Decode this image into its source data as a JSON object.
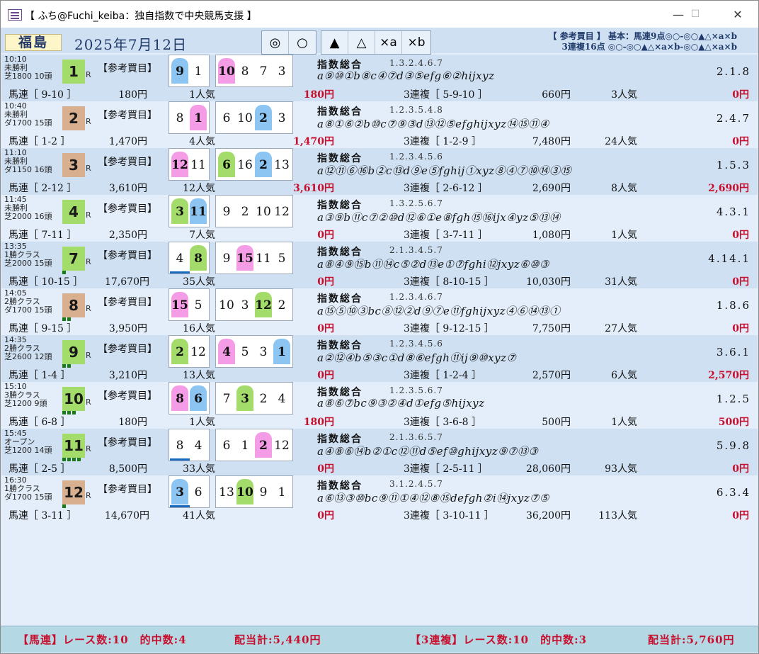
{
  "window": {
    "title": "【 ふち@Fuchi_keiba：独自指数で中央競馬支援 】",
    "minimize": "—",
    "maximize": "☐",
    "close": "✕"
  },
  "header": {
    "venue": "福島",
    "date": "2025年7月12日",
    "marks": [
      "◎",
      "○",
      "▲",
      "△",
      "×a",
      "×b"
    ],
    "info_line1": "【 参考買目 】 基本：馬連9点◎○-◎○▲△×a×b",
    "info_line2": "3連複16点 ◎○-◎○▲△×a×b-◎○▲△×a×b"
  },
  "races": [
    {
      "time": "10:10",
      "cls": "未勝利",
      "course": "芝1800 10頭",
      "num": "1",
      "num_color": "#a4dc6c",
      "dots": 0,
      "sanko": "【参考買目】",
      "top": [
        {
          "n": "9",
          "c": "blue"
        },
        {
          "n": "1",
          "c": "none"
        }
      ],
      "others": [
        {
          "n": "10",
          "c": "pink"
        },
        {
          "n": "8",
          "c": "none"
        },
        {
          "n": "7",
          "c": "none"
        },
        {
          "n": "3",
          "c": "none"
        }
      ],
      "shisu": "指数総合",
      "shisu_nums": "1.3.2.4.6.7",
      "seq": "a⑨⑩①b⑧c④⑦d③⑤efg⑥②hijxyz",
      "trio": "2.1.8",
      "umaren": "馬連［ 9-10 ］",
      "umaren_pay": "180円",
      "umaren_pop": "1人気",
      "umaren_hit": "180円",
      "sanren": "3連複［ 5-9-10 ］",
      "sanren_pay": "660円",
      "sanren_pop": "3人気",
      "sanren_hit": "0円"
    },
    {
      "time": "10:40",
      "cls": "未勝利",
      "course": "ダ1700 15頭",
      "num": "2",
      "num_color": "#d8b090",
      "dots": 0,
      "sanko": "【参考買目】",
      "top": [
        {
          "n": "8",
          "c": "none"
        },
        {
          "n": "1",
          "c": "pink"
        }
      ],
      "others": [
        {
          "n": "6",
          "c": "none"
        },
        {
          "n": "10",
          "c": "none"
        },
        {
          "n": "2",
          "c": "blue"
        },
        {
          "n": "3",
          "c": "none"
        }
      ],
      "shisu": "指数総合",
      "shisu_nums": "1.2.3.5.4.8",
      "seq": "a⑧①⑥②b⑩c⑦⑨③d⑬⑫⑤efghijxyz⑭⑮⑪④",
      "trio": "2.4.7",
      "umaren": "馬連［ 1-2 ］",
      "umaren_pay": "1,470円",
      "umaren_pop": "4人気",
      "umaren_hit": "1,470円",
      "sanren": "3連複［ 1-2-9 ］",
      "sanren_pay": "7,480円",
      "sanren_pop": "24人気",
      "sanren_hit": "0円"
    },
    {
      "time": "11:10",
      "cls": "未勝利",
      "course": "ダ1150 16頭",
      "num": "3",
      "num_color": "#d8b090",
      "dots": 0,
      "sanko": "【参考買目】",
      "top": [
        {
          "n": "12",
          "c": "pink"
        },
        {
          "n": "11",
          "c": "none"
        }
      ],
      "others": [
        {
          "n": "6",
          "c": "green"
        },
        {
          "n": "16",
          "c": "none"
        },
        {
          "n": "2",
          "c": "blue"
        },
        {
          "n": "13",
          "c": "none"
        }
      ],
      "shisu": "指数総合",
      "shisu_nums": "1.2.3.4.5.6",
      "seq": "a⑫⑪⑥⑯b②c⑬d⑨e⑤fghij①xyz⑧④⑦⑩⑭③⑮",
      "trio": "1.5.3",
      "umaren": "馬連［ 2-12 ］",
      "umaren_pay": "3,610円",
      "umaren_pop": "12人気",
      "umaren_hit": "3,610円",
      "sanren": "3連複［ 2-6-12 ］",
      "sanren_pay": "2,690円",
      "sanren_pop": "8人気",
      "sanren_hit": "2,690円"
    },
    {
      "time": "11:45",
      "cls": "未勝利",
      "course": "芝2000 16頭",
      "num": "4",
      "num_color": "#a4dc6c",
      "dots": 0,
      "sanko": "【参考買目】",
      "top": [
        {
          "n": "3",
          "c": "green"
        },
        {
          "n": "11",
          "c": "blue"
        }
      ],
      "others": [
        {
          "n": "9",
          "c": "none"
        },
        {
          "n": "2",
          "c": "none"
        },
        {
          "n": "10",
          "c": "none"
        },
        {
          "n": "12",
          "c": "none"
        }
      ],
      "shisu": "指数総合",
      "shisu_nums": "1.3.2.5.6.7",
      "seq": "a③⑨b⑪c⑦②⑩d⑫⑥①e⑧fgh⑮⑯ijx④yz⑤⑬⑭",
      "trio": "4.3.1",
      "umaren": "馬連［ 7-11 ］",
      "umaren_pay": "2,350円",
      "umaren_pop": "7人気",
      "umaren_hit": "0円",
      "sanren": "3連複［ 3-7-11 ］",
      "sanren_pay": "1,080円",
      "sanren_pop": "1人気",
      "sanren_hit": "0円"
    },
    {
      "time": "13:35",
      "cls": "1勝クラス",
      "course": "芝2000 15頭",
      "num": "7",
      "num_color": "#a4dc6c",
      "dots": 1,
      "sanko": "【参考買目】",
      "top": [
        {
          "n": "4",
          "c": "none",
          "ul": true
        },
        {
          "n": "8",
          "c": "green"
        }
      ],
      "others": [
        {
          "n": "9",
          "c": "none"
        },
        {
          "n": "15",
          "c": "pink"
        },
        {
          "n": "11",
          "c": "none"
        },
        {
          "n": "5",
          "c": "none"
        }
      ],
      "shisu": "指数総合",
      "shisu_nums": "2.1.3.4.5.7",
      "seq": "a⑧④⑨⑮b⑪⑭c⑤②d⑬e①⑦fghi⑫jxyz⑥⑩③",
      "trio": "4.14.1",
      "umaren": "馬連［ 10-15 ］",
      "umaren_pay": "17,670円",
      "umaren_pop": "35人気",
      "umaren_hit": "0円",
      "sanren": "3連複［ 8-10-15 ］",
      "sanren_pay": "10,030円",
      "sanren_pop": "31人気",
      "sanren_hit": "0円"
    },
    {
      "time": "14:05",
      "cls": "2勝クラス",
      "course": "ダ1700 15頭",
      "num": "8",
      "num_color": "#d8b090",
      "dots": 2,
      "sanko": "【参考買目】",
      "top": [
        {
          "n": "15",
          "c": "pink"
        },
        {
          "n": "5",
          "c": "none"
        }
      ],
      "others": [
        {
          "n": "10",
          "c": "none"
        },
        {
          "n": "3",
          "c": "none"
        },
        {
          "n": "12",
          "c": "green"
        },
        {
          "n": "2",
          "c": "none"
        }
      ],
      "shisu": "指数総合",
      "shisu_nums": "1.2.3.4.6.7",
      "seq": "a⑮⑤⑩③bc⑧⑫②d⑨⑦e⑪fghijxyz④⑥⑭⑬①",
      "trio": "1.8.6",
      "umaren": "馬連［ 9-15 ］",
      "umaren_pay": "3,950円",
      "umaren_pop": "16人気",
      "umaren_hit": "0円",
      "sanren": "3連複［ 9-12-15 ］",
      "sanren_pay": "7,750円",
      "sanren_pop": "27人気",
      "sanren_hit": "0円"
    },
    {
      "time": "14:35",
      "cls": "2勝クラス",
      "course": "芝2600 12頭",
      "num": "9",
      "num_color": "#a4dc6c",
      "dots": 2,
      "sanko": "【参考買目】",
      "top": [
        {
          "n": "2",
          "c": "green"
        },
        {
          "n": "12",
          "c": "none"
        }
      ],
      "others": [
        {
          "n": "4",
          "c": "pink"
        },
        {
          "n": "5",
          "c": "none"
        },
        {
          "n": "3",
          "c": "none"
        },
        {
          "n": "1",
          "c": "blue"
        }
      ],
      "shisu": "指数総合",
      "shisu_nums": "1.2.3.4.5.6",
      "seq": "a②⑫④b⑤③c①d⑧⑥efgh⑪ij⑨⑩xyz⑦",
      "trio": "3.6.1",
      "umaren": "馬連［ 1-4 ］",
      "umaren_pay": "3,210円",
      "umaren_pop": "13人気",
      "umaren_hit": "0円",
      "sanren": "3連複［ 1-2-4 ］",
      "sanren_pay": "2,570円",
      "sanren_pop": "6人気",
      "sanren_hit": "2,570円"
    },
    {
      "time": "15:10",
      "cls": "3勝クラス",
      "course": "芝1200 9頭",
      "num": "10",
      "num_color": "#a4dc6c",
      "dots": 3,
      "sanko": "【参考買目】",
      "top": [
        {
          "n": "8",
          "c": "pink"
        },
        {
          "n": "6",
          "c": "blue"
        }
      ],
      "others": [
        {
          "n": "7",
          "c": "none"
        },
        {
          "n": "3",
          "c": "green"
        },
        {
          "n": "2",
          "c": "none"
        },
        {
          "n": "4",
          "c": "none"
        }
      ],
      "shisu": "指数総合",
      "shisu_nums": "1.2.3.5.6.7",
      "seq": "a⑧⑥⑦bc⑨③②④d①efg⑤hijxyz",
      "trio": "1.2.5",
      "umaren": "馬連［ 6-8 ］",
      "umaren_pay": "180円",
      "umaren_pop": "1人気",
      "umaren_hit": "180円",
      "sanren": "3連複［ 3-6-8 ］",
      "sanren_pay": "500円",
      "sanren_pop": "1人気",
      "sanren_hit": "500円"
    },
    {
      "time": "15:45",
      "cls": "オープン",
      "course": "芝1200 14頭",
      "num": "11",
      "num_color": "#a4dc6c",
      "dots": 4,
      "sanko": "【参考買目】",
      "top": [
        {
          "n": "8",
          "c": "none",
          "ul": true
        },
        {
          "n": "4",
          "c": "none"
        }
      ],
      "others": [
        {
          "n": "6",
          "c": "none"
        },
        {
          "n": "1",
          "c": "none"
        },
        {
          "n": "2",
          "c": "pink"
        },
        {
          "n": "12",
          "c": "none"
        }
      ],
      "shisu": "指数総合",
      "shisu_nums": "2.1.3.6.5.7",
      "seq": "a④⑧⑥⑭b②①c⑫⑪d⑤ef⑩ghijxyz⑨⑦⑬③",
      "trio": "5.9.8",
      "umaren": "馬連［ 2-5 ］",
      "umaren_pay": "8,500円",
      "umaren_pop": "33人気",
      "umaren_hit": "0円",
      "sanren": "3連複［ 2-5-11 ］",
      "sanren_pay": "28,060円",
      "sanren_pop": "93人気",
      "sanren_hit": "0円"
    },
    {
      "time": "16:30",
      "cls": "1勝クラス",
      "course": "ダ1700 15頭",
      "num": "12",
      "num_color": "#d8b090",
      "dots": 1,
      "sanko": "【参考買目】",
      "top": [
        {
          "n": "3",
          "c": "blue",
          "ul": true
        },
        {
          "n": "6",
          "c": "none"
        }
      ],
      "others": [
        {
          "n": "13",
          "c": "none"
        },
        {
          "n": "10",
          "c": "green"
        },
        {
          "n": "9",
          "c": "none"
        },
        {
          "n": "1",
          "c": "none"
        }
      ],
      "shisu": "指数総合",
      "shisu_nums": "3.1.2.4.5.7",
      "seq": "a⑥⑬③⑩bc⑨⑪①④⑫⑧⑮defgh②i⑭jxyz⑦⑤",
      "trio": "6.3.4",
      "umaren": "馬連［ 3-11 ］",
      "umaren_pay": "14,670円",
      "umaren_pop": "41人気",
      "umaren_hit": "0円",
      "sanren": "3連複［ 3-10-11 ］",
      "sanren_pay": "36,200円",
      "sanren_pop": "113人気",
      "sanren_hit": "0円"
    }
  ],
  "footer": {
    "umaren": "【馬連】レース数:10　的中数:4",
    "umaren_total": "配当計:5,440円",
    "sanren": "【3連複】レース数:10　的中数:3",
    "sanren_total": "配当計:5,760円"
  }
}
